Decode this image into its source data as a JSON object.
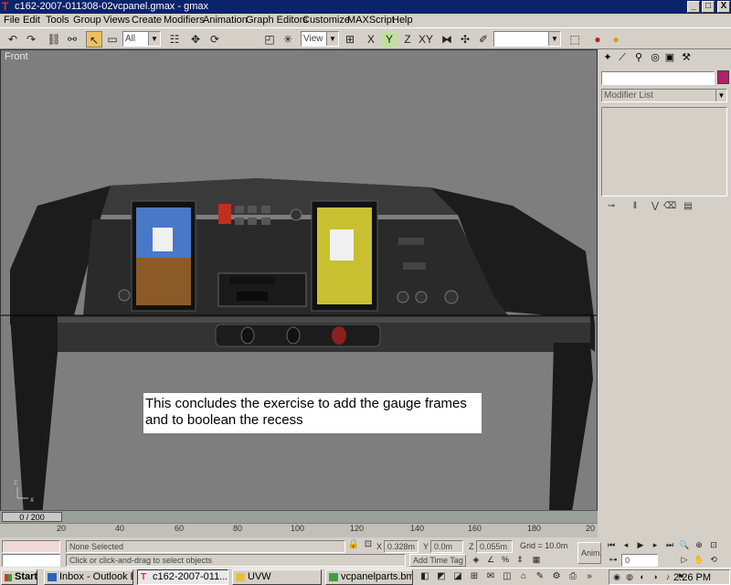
{
  "window": {
    "title": "c162-2007-011308-02vcpanel.gmax - gmax",
    "minimize": "_",
    "maximize": "□",
    "close": "X"
  },
  "menu": [
    "File",
    "Edit",
    "Tools",
    "Group",
    "Views",
    "Create",
    "Modifiers",
    "Animation",
    "Graph Editors",
    "Customize",
    "MAXScript",
    "Help"
  ],
  "toolbar": {
    "selection_filter": "All",
    "ref_coord": "View",
    "named_selection": ""
  },
  "viewport": {
    "label": "Front",
    "caption": "This concludes the exercise to add the gauge frames and to boolean the recess"
  },
  "command_panel": {
    "modifier_list": "Modifier List",
    "object_color": "#b0206a"
  },
  "timeline": {
    "frame_indicator": "0 / 200",
    "ticks": [
      "20",
      "40",
      "60",
      "80",
      "100",
      "120",
      "140",
      "160",
      "180",
      "20"
    ]
  },
  "status": {
    "selection": "None Selected",
    "prompt": "Click or click-and-drag to select objects",
    "x_label": "X",
    "x_value": "0.328m",
    "y_label": "Y",
    "y_value": "0.0m",
    "z_label": "Z",
    "z_value": "0.055m",
    "grid": "Grid = 10.0m",
    "add_time_tag": "Add Time Tag",
    "anim": "Anim.",
    "frame_field": "0"
  },
  "taskbar": {
    "start": "Start",
    "tasks": [
      "Inbox - Outlook E...",
      "c162-2007-011...",
      "UVW",
      "vcpanelparts.bmp ..."
    ],
    "clock": "2:26 PM"
  }
}
